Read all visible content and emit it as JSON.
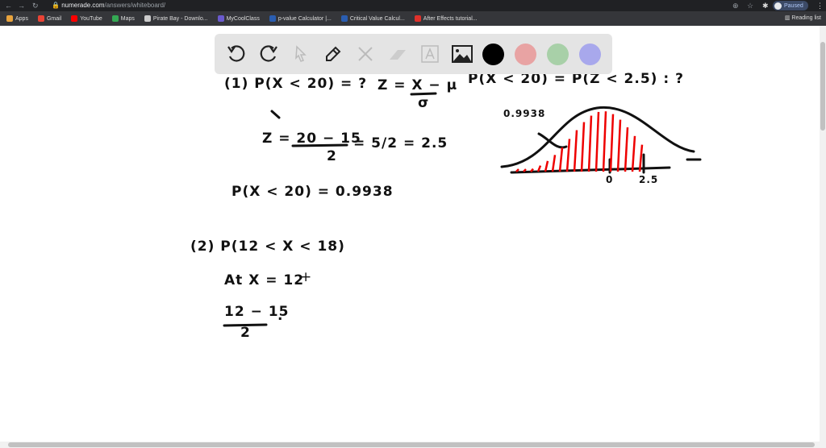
{
  "browser": {
    "url_domain": "numerade.com",
    "url_path": "/answers/whiteboard/",
    "profile_status": "Paused",
    "reading_list": "Reading list",
    "bookmarks": [
      {
        "label": "Apps",
        "color": "#e8a33d"
      },
      {
        "label": "Gmail",
        "color": "#ea4335"
      },
      {
        "label": "YouTube",
        "color": "#ff0000"
      },
      {
        "label": "Maps",
        "color": "#34a853"
      },
      {
        "label": "Pirate Bay - Downlo...",
        "color": "#cccccc"
      },
      {
        "label": "MyCoolClass",
        "color": "#6a5acd"
      },
      {
        "label": "p-value Calculator |...",
        "color": "#2a5db0"
      },
      {
        "label": "Critical Value Calcul...",
        "color": "#2a5db0"
      },
      {
        "label": "After Effects tutorial...",
        "color": "#e0312b"
      }
    ]
  },
  "toolbar": {
    "tools": [
      "undo",
      "redo",
      "select",
      "pen",
      "tools",
      "eraser",
      "text",
      "image"
    ],
    "colors": [
      "#000000",
      "#e8a3a3",
      "#a8d0a8",
      "#a8a8ec"
    ]
  },
  "whiteboard": {
    "q1_label": "(1)  P(X < 20) = ?",
    "z_formula_num": "Z = X − μ",
    "z_formula_den": "σ",
    "prob_equiv": "P(X < 20) = P(Z < 2.5) : ?",
    "z_calc_a": "Z = 20 − 15",
    "z_calc_den": "2",
    "z_calc_b": "= 5/2 = 2.5",
    "result": "P(X < 20) = 0.9938",
    "q2_label": "(2)   P(12 < X < 18)",
    "at_x": "At X = 12",
    "calc2_num": "12 − 15",
    "calc2_den": "2",
    "graph_area_label": "0.9938",
    "graph_zero": "0",
    "graph_z": "2.5",
    "cursor": "+"
  }
}
